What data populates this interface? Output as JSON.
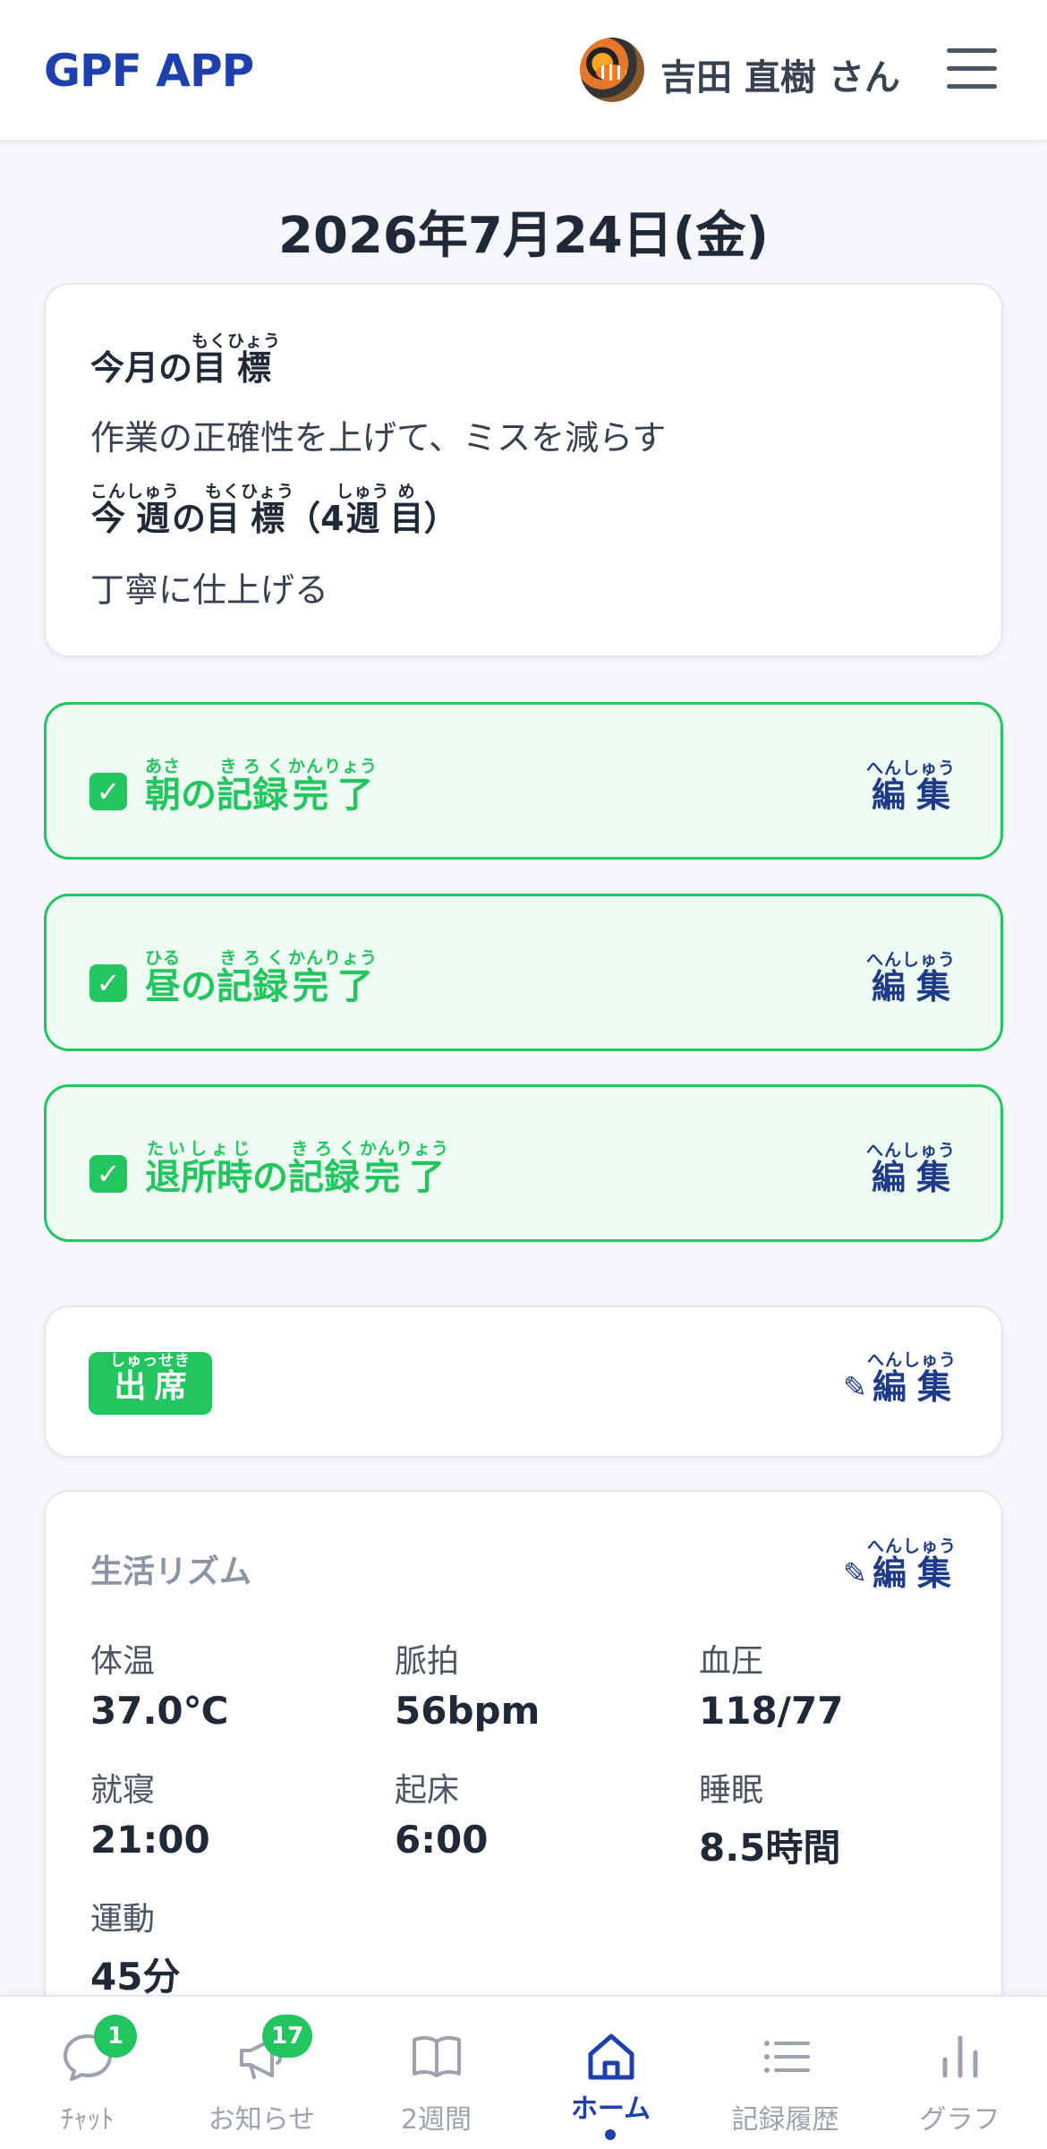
{
  "header": {
    "brand": "GPF APP",
    "user_name": "吉田 直樹 さん"
  },
  "date": "2026年7月24日(金)",
  "goals": {
    "monthly_title": {
      "base1": "今月の",
      "base2": "目",
      "rt2": "もく",
      "base3": "標",
      "rt3": "ひょう"
    },
    "monthly_text": "作業の正確性を上げて、ミスを減らす",
    "weekly_title": {
      "base1": "今",
      "rt1": "こん",
      "base2": "週",
      "rt2": "しゅう",
      "base3": "の",
      "base4": "目",
      "rt4": "もく",
      "base5": "標",
      "rt5": "ひょう",
      "base6": "（4",
      "base7": "週",
      "rt7": "しゅう",
      "base8": "目",
      "rt8": "め",
      "base9": "）"
    },
    "weekly_text": "丁寧に仕上げる"
  },
  "records": [
    {
      "segments": [
        {
          "b": "朝",
          "r": "あさ"
        },
        {
          "b": "の",
          "r": ""
        },
        {
          "b": "記録",
          "r": "きろく"
        },
        {
          "b": "完了",
          "r": "かんりょう"
        }
      ]
    },
    {
      "segments": [
        {
          "b": "昼",
          "r": "ひる"
        },
        {
          "b": "の",
          "r": ""
        },
        {
          "b": "記録",
          "r": "きろく"
        },
        {
          "b": "完了",
          "r": "かんりょう"
        }
      ]
    },
    {
      "segments": [
        {
          "b": "退所時",
          "r": "たいしょじ"
        },
        {
          "b": "の",
          "r": ""
        },
        {
          "b": "記録",
          "r": "きろく"
        },
        {
          "b": "完了",
          "r": "かんりょう"
        }
      ]
    }
  ],
  "edit_label": {
    "base": "編集",
    "rt": "へんしゅう"
  },
  "attendance": {
    "base": "出席",
    "rt": "しゅっせき"
  },
  "rhythm": {
    "title": "生活リズム",
    "metrics": [
      {
        "label": "体温",
        "value": "37.0℃"
      },
      {
        "label": "脈拍",
        "value": "56bpm"
      },
      {
        "label": "血圧",
        "value": "118/77"
      },
      {
        "label": "就寝",
        "value": "21:00"
      },
      {
        "label": "起床",
        "value": "6:00"
      },
      {
        "label": "睡眠",
        "value": "8.5時間"
      },
      {
        "label": "運動",
        "value": "45分"
      }
    ]
  },
  "nav": {
    "chat": {
      "label": "ﾁｬｯﾄ",
      "badge": "1"
    },
    "news": {
      "label": "お知らせ",
      "badge": "17"
    },
    "two_weeks": {
      "label": "2週間"
    },
    "home": {
      "label": "ホーム"
    },
    "history": {
      "label": "記録履歴"
    },
    "graph": {
      "label": "グラフ"
    }
  },
  "colors": {
    "brand": "#1e40af",
    "success": "#22c55e",
    "success_bg": "#eefbf2",
    "edit": "#1e3a8a"
  }
}
